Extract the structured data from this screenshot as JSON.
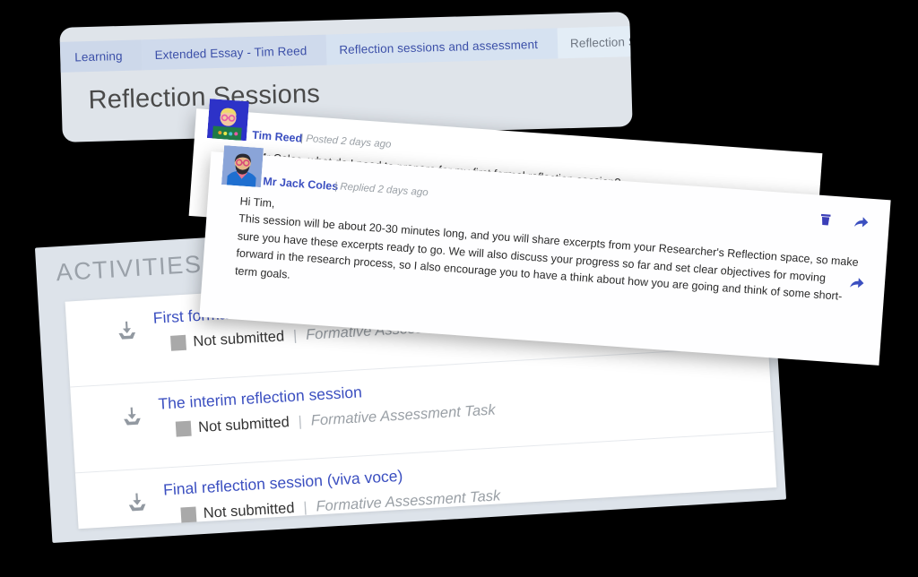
{
  "header": {
    "page_title": "Reflection Sessions",
    "breadcrumb": [
      {
        "label": "Learning",
        "current": false
      },
      {
        "label": "Extended Essay - Tim Reed",
        "current": false
      },
      {
        "label": "Reflection sessions and assessment",
        "current": false
      },
      {
        "label": "Reflection Sessions",
        "current": true
      }
    ]
  },
  "activities": {
    "section_title": "ACTIVITIES",
    "items": [
      {
        "title": "First formal reflection session",
        "status": "Not submitted",
        "separator": "|",
        "assessment_type": "Formative Assessment Task",
        "icon": "download-icon"
      },
      {
        "title": "The interim reflection session",
        "status": "Not submitted",
        "separator": "|",
        "assessment_type": "Formative Assessment Task",
        "icon": "download-icon"
      },
      {
        "title": "Final reflection session (viva voce)",
        "status": "Not submitted",
        "separator": "|",
        "assessment_type": "Formative Assessment Task",
        "icon": "download-icon"
      }
    ]
  },
  "comments": [
    {
      "author": "Tim Reed",
      "separator": "|",
      "timestamp": "Posted 2 days ago",
      "body": "Hi Mr Coles, what do I need to prepare for my first formal reflection session?",
      "avatar": "student-avatar"
    },
    {
      "author": "Mr Jack Coles",
      "separator": "|",
      "timestamp": "Replied 2 days ago",
      "greeting": "Hi Tim,",
      "body": "This session will be about 20-30 minutes long, and you will share excerpts from your Researcher's Reflection space, so make sure you have these excerpts ready to go. We will also discuss your progress so far and set clear objectives for moving forward in the research process, so I also encourage you to have a think about how you are going and think of some short-term goals.",
      "avatar": "teacher-avatar"
    }
  ],
  "actions": {
    "delete_icon": "trash-icon",
    "reply_icon": "reply-arrow-icon"
  },
  "colors": {
    "link_blue": "#3b4fc0",
    "header_bg": "#dfe4ea",
    "panel_bg": "#dde3ea",
    "status_grey": "#a9a9a9",
    "muted_text": "#9aa0a6"
  }
}
